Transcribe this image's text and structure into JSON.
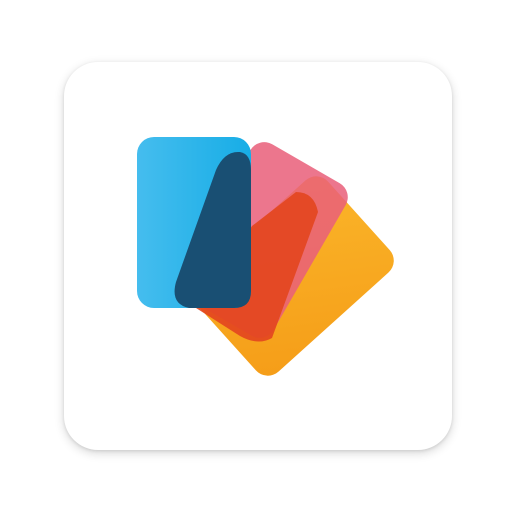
{
  "app_icon": {
    "name": "cards-stack-logo",
    "colors": {
      "tile_background": "#ffffff",
      "card_front": "#29b2ea",
      "card_front_overlap": "#194f73",
      "card_middle": "#e9607a",
      "card_middle_overlap": "#e3461f",
      "card_back": "#f8a81b"
    }
  }
}
